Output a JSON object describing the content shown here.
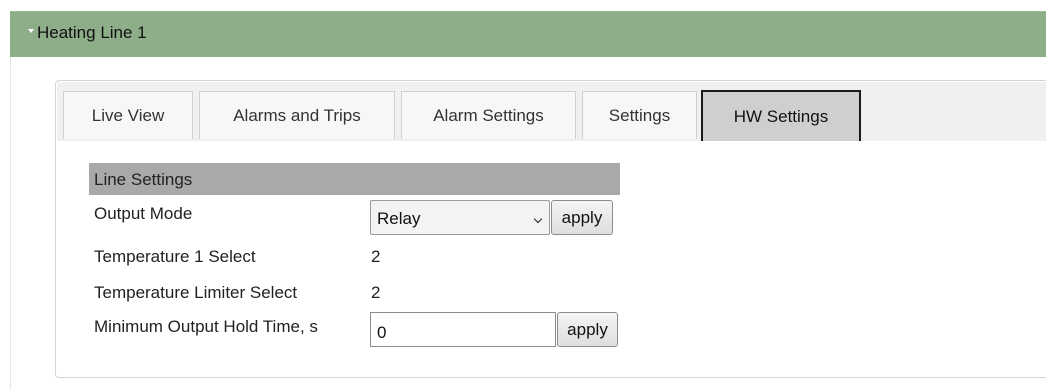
{
  "panel": {
    "title": "Heating Line 1"
  },
  "tabs": [
    {
      "label": "Live View"
    },
    {
      "label": "Alarms and Trips"
    },
    {
      "label": "Alarm Settings"
    },
    {
      "label": "Settings"
    },
    {
      "label": "HW Settings",
      "active": true
    }
  ],
  "section": {
    "title": "Line Settings"
  },
  "rows": {
    "output_mode": {
      "label": "Output Mode",
      "selected": "Relay",
      "apply_label": "apply"
    },
    "temp1_select": {
      "label": "Temperature 1 Select",
      "value": "2"
    },
    "temp_limiter_select": {
      "label": "Temperature Limiter Select",
      "value": "2"
    },
    "min_hold_time": {
      "label": "Minimum Output Hold Time, s",
      "value": "0",
      "apply_label": "apply"
    }
  },
  "colors": {
    "header_bg": "#8eae8a",
    "section_bg": "#a9a9a9",
    "active_tab_bg": "#cfcfcf"
  }
}
